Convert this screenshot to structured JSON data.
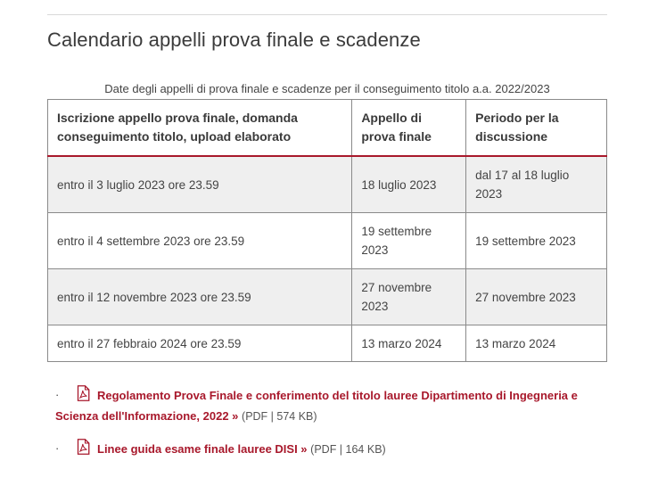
{
  "page": {
    "title": "Calendario appelli prova finale e scadenze"
  },
  "table": {
    "caption": "Date degli appelli di prova finale e scadenze per il conseguimento titolo a.a. 2022/2023",
    "headers": [
      "Iscrizione appello prova finale, domanda conseguimento titolo, upload elaborato",
      "Appello di prova finale",
      "Periodo per la discussione"
    ],
    "rows": [
      [
        "entro il 3 luglio 2023 ore 23.59",
        "18 luglio 2023",
        "dal 17 al 18 luglio 2023"
      ],
      [
        "entro il 4 settembre 2023 ore 23.59",
        "19 settembre 2023",
        "19 settembre 2023"
      ],
      [
        "entro il 12 novembre 2023 ore 23.59",
        "27 novembre 2023",
        "27 novembre 2023"
      ],
      [
        "entro il 27 febbraio 2024 ore 23.59",
        "13 marzo 2024",
        "13 marzo 2024"
      ]
    ]
  },
  "documents": [
    {
      "bullet": "·",
      "icon": "pdf-icon",
      "label": "Regolamento Prova Finale e conferimento del titolo lauree Dipartimento di Ingegneria e Scienza dell'Informazione, 2022 »",
      "meta": "(PDF | 574 KB)"
    },
    {
      "bullet": "·",
      "icon": "pdf-icon",
      "label": "Linee guida esame finale lauree DISI »",
      "meta": "(PDF | 164 KB)"
    }
  ],
  "colors": {
    "accent": "#a8182b",
    "row_shade": "#efefef",
    "border": "#8a8a8a"
  }
}
